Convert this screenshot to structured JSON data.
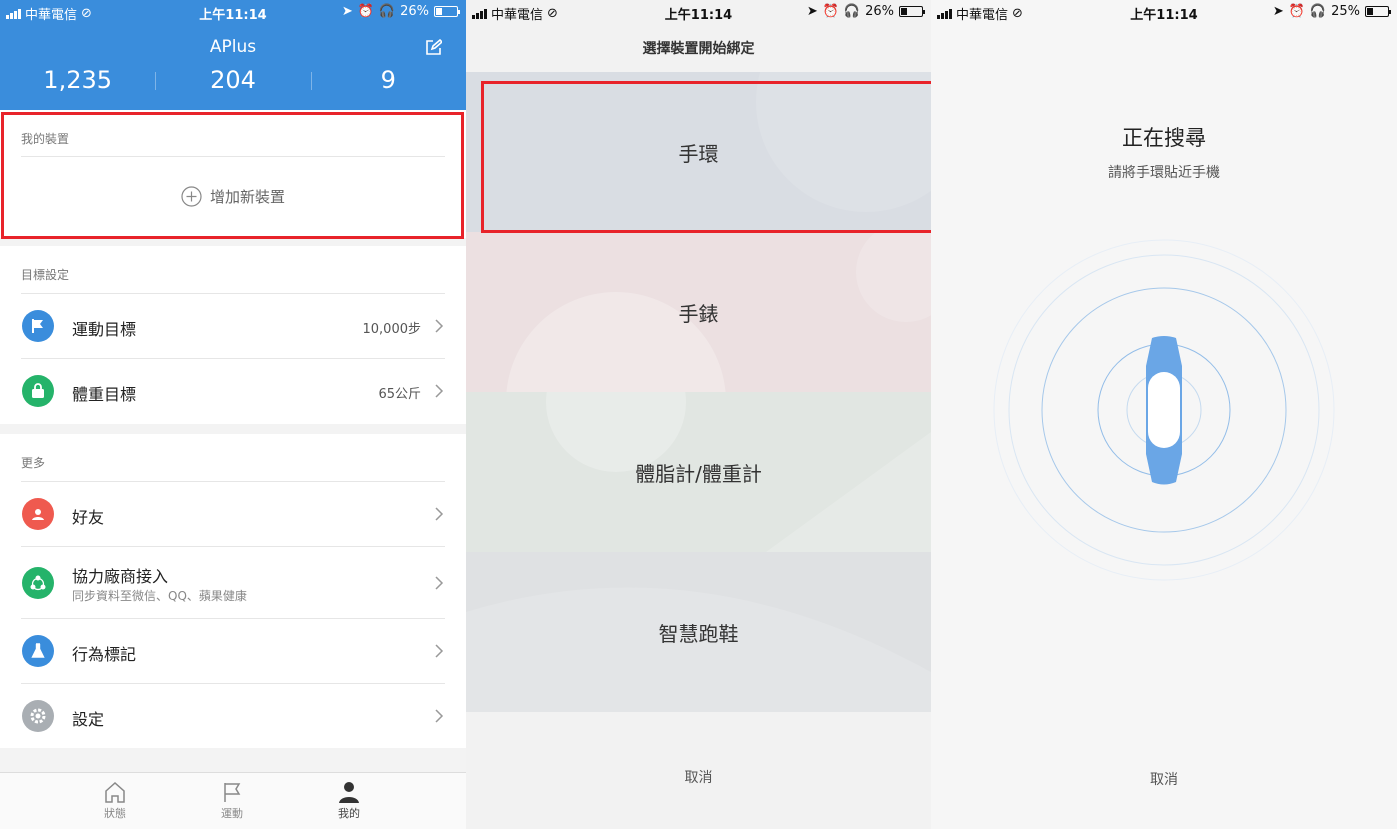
{
  "status_bars": [
    {
      "carrier": "中華電信",
      "time": "上午11:14",
      "battery": "26%",
      "battery_level": 0.26
    },
    {
      "carrier": "中華電信",
      "time": "上午11:14",
      "battery": "26%",
      "battery_level": 0.26
    },
    {
      "carrier": "中華電信",
      "time": "上午11:14",
      "battery": "25%",
      "battery_level": 0.25
    }
  ],
  "profile": {
    "app_title": "APlus",
    "stats": [
      "1,235",
      "204",
      "9"
    ],
    "header_color": "#3a8ddc",
    "my_devices": {
      "title": "我的裝置",
      "add_device_label": "增加新裝置"
    },
    "goals": {
      "title": "目標設定",
      "items": [
        {
          "label": "運動目標",
          "value": "10,000步",
          "icon": "flag-icon",
          "color": "#3a8ddc"
        },
        {
          "label": "體重目標",
          "value": "65公斤",
          "icon": "weight-icon",
          "color": "#25b36a"
        }
      ]
    },
    "more": {
      "title": "更多",
      "items": [
        {
          "label": "好友",
          "sub": "",
          "icon": "friend-icon",
          "color": "#ef5a4f"
        },
        {
          "label": "協力廠商接入",
          "sub": "同步資料至微信、QQ、蘋果健康",
          "icon": "share-icon",
          "color": "#25b36a"
        },
        {
          "label": "行為標記",
          "sub": "",
          "icon": "flask-icon",
          "color": "#3a8ddc"
        },
        {
          "label": "設定",
          "sub": "",
          "icon": "gear-icon",
          "color": "#a9aeb3"
        }
      ]
    },
    "tabs": [
      {
        "label": "狀態",
        "icon": "home-icon"
      },
      {
        "label": "運動",
        "icon": "flag-outline-icon"
      },
      {
        "label": "我的",
        "icon": "person-icon"
      }
    ]
  },
  "device_select": {
    "title": "選擇裝置開始綁定",
    "options": [
      {
        "label": "手環",
        "color": "#d9dde3"
      },
      {
        "label": "手錶",
        "color": "#ece0e1"
      },
      {
        "label": "體脂計/體重計",
        "color": "#e1e6e2"
      },
      {
        "label": "智慧跑鞋",
        "color": "#dfe1e3"
      }
    ],
    "cancel_label": "取消"
  },
  "searching": {
    "title": "正在搜尋",
    "subtitle": "請將手環貼近手機",
    "cancel_label": "取消",
    "band_color": "#6aa6e6"
  },
  "highlight_color": "#e8232a"
}
